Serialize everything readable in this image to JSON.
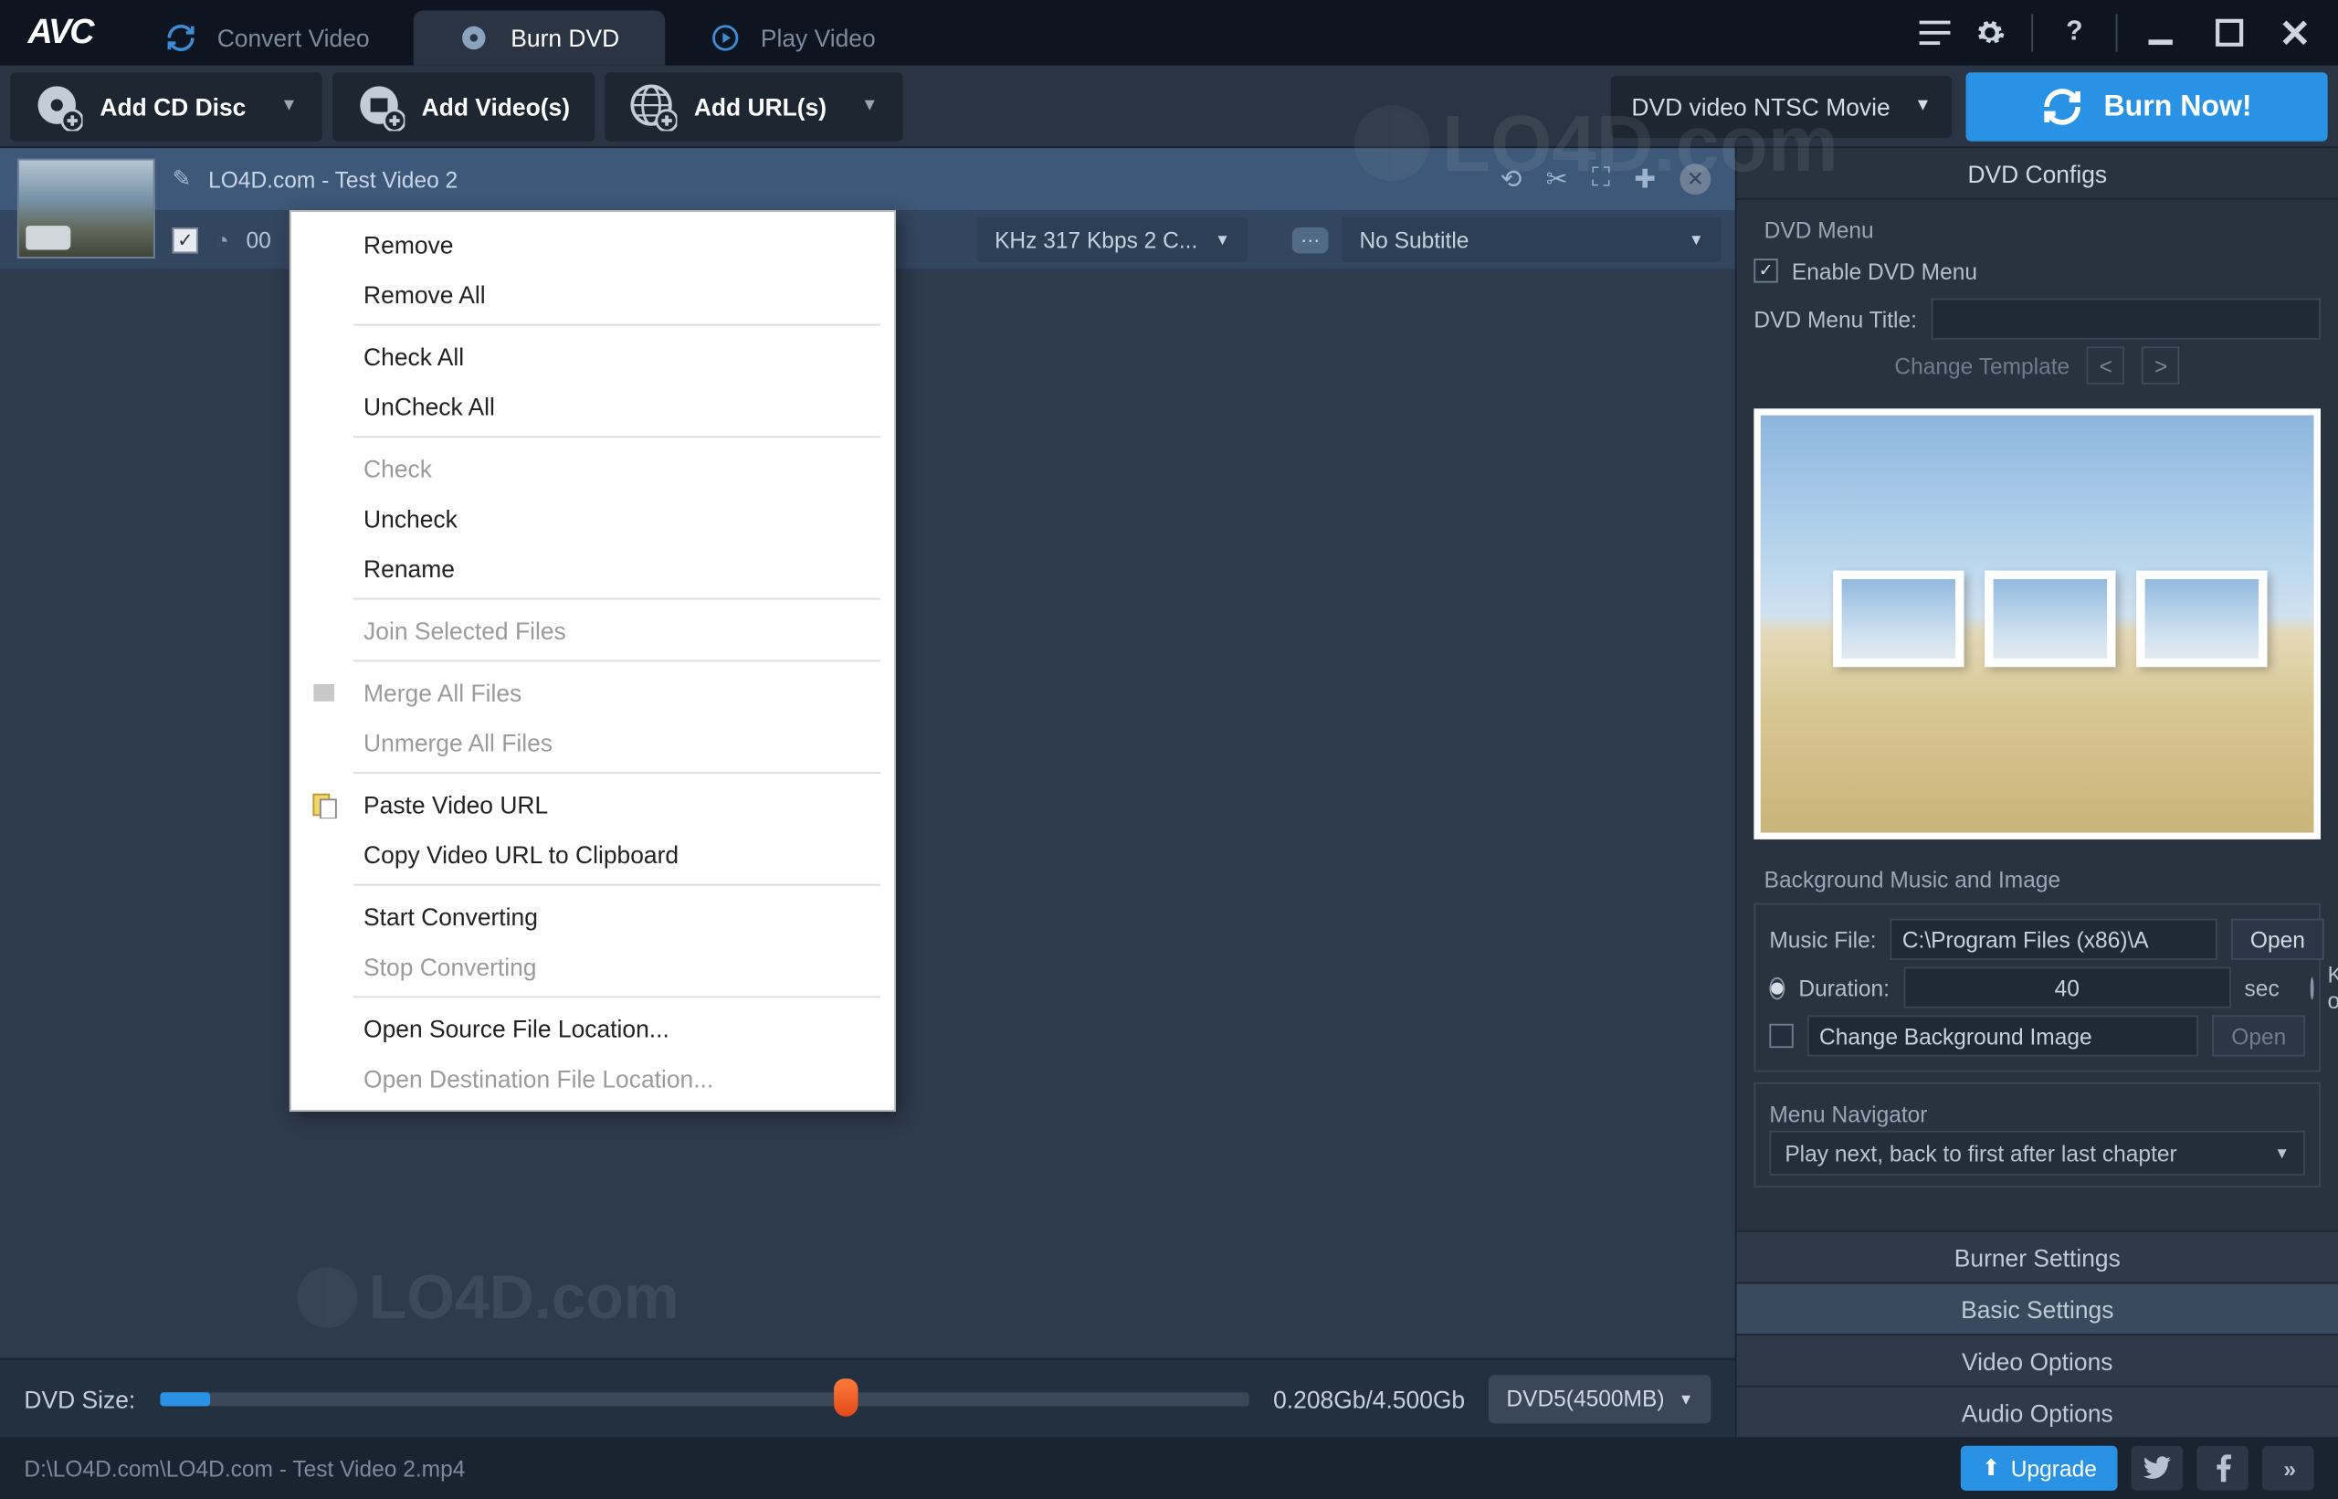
{
  "app": {
    "logo": "AVC"
  },
  "tabs": [
    {
      "id": "convert",
      "label": "Convert Video"
    },
    {
      "id": "burn",
      "label": "Burn DVD"
    },
    {
      "id": "play",
      "label": "Play Video"
    }
  ],
  "toolbar": {
    "add_cd": "Add CD Disc",
    "add_videos": "Add Video(s)",
    "add_urls": "Add URL(s)",
    "profile": "DVD video NTSC Movie",
    "burn_now": "Burn Now!"
  },
  "video_item": {
    "title": "LO4D.com - Test Video 2",
    "time_fragment": "00",
    "format_info": "KHz 317 Kbps 2 C...",
    "subtitle": "No Subtitle"
  },
  "context_menu": [
    {
      "label": "Remove",
      "enabled": true
    },
    {
      "label": "Remove All",
      "enabled": true
    },
    {
      "sep": true
    },
    {
      "label": "Check All",
      "enabled": true
    },
    {
      "label": "UnCheck All",
      "enabled": true
    },
    {
      "sep": true
    },
    {
      "label": "Check",
      "enabled": false
    },
    {
      "label": "Uncheck",
      "enabled": true
    },
    {
      "label": "Rename",
      "enabled": true
    },
    {
      "sep": true
    },
    {
      "label": "Join Selected Files",
      "enabled": false
    },
    {
      "sep": true
    },
    {
      "label": "Merge All Files",
      "enabled": false,
      "icon": "merge"
    },
    {
      "label": "Unmerge All Files",
      "enabled": false
    },
    {
      "sep": true
    },
    {
      "label": "Paste Video URL",
      "enabled": true,
      "icon": "paste"
    },
    {
      "label": "Copy Video URL to Clipboard",
      "enabled": true
    },
    {
      "sep": true
    },
    {
      "label": "Start Converting",
      "enabled": true
    },
    {
      "label": "Stop Converting",
      "enabled": false
    },
    {
      "sep": true
    },
    {
      "label": "Open Source File Location...",
      "enabled": true
    },
    {
      "label": "Open Destination File Location...",
      "enabled": false
    }
  ],
  "dvd_size": {
    "label": "DVD Size:",
    "text": "0.208Gb/4.500Gb",
    "disc": "DVD5(4500MB)",
    "fill_pct": 4.6,
    "marker_pct": 63
  },
  "statusbar": {
    "path": "D:\\LO4D.com\\LO4D.com - Test Video 2.mp4",
    "upgrade": "Upgrade"
  },
  "rpanel": {
    "title": "DVD Configs",
    "dvd_menu_label": "DVD Menu",
    "enable_menu": "Enable DVD Menu",
    "menu_title_label": "DVD Menu Title:",
    "menu_title_value": "",
    "change_template": "Change Template",
    "bg_section": "Background Music and Image",
    "music_file_label": "Music File:",
    "music_file_value": "C:\\Program Files (x86)\\A",
    "open": "Open",
    "duration_label": "Duration:",
    "duration_value": "40",
    "sec": "sec",
    "keep_original": "Keep original",
    "change_bg": "Change Background Image",
    "open_disabled": "Open",
    "nav_label": "Menu Navigator",
    "nav_value": "Play next, back to first after last chapter",
    "accordion": [
      "Burner Settings",
      "Basic Settings",
      "Video Options",
      "Audio Options"
    ]
  },
  "watermark": "LO4D.com"
}
